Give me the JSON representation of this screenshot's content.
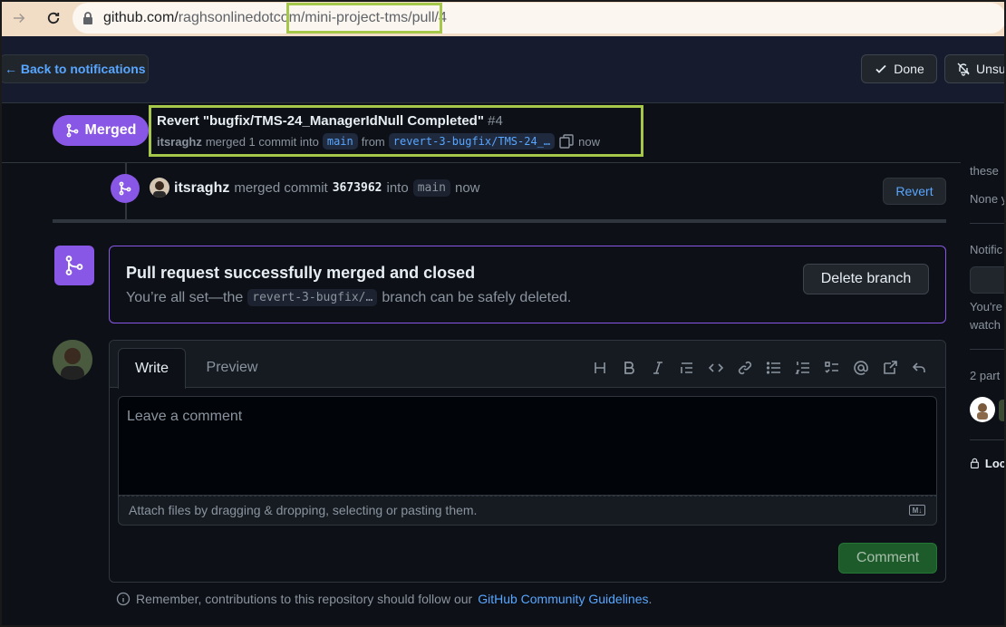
{
  "browser": {
    "url_host": "github.com/",
    "url_host_rest": "raghsonlinedotcom",
    "url_path": "/mini-project-tms/pull/4"
  },
  "notifications": {
    "back_label": "← Back to notifications",
    "done_label": "Done",
    "unsubscribe_label": "Unsu"
  },
  "pr": {
    "state_label": "Merged",
    "title": "Revert \"bugfix/TMS-24_ManagerIdNull Completed\"",
    "number": "#4",
    "author": "itsraghz",
    "merge_text": "merged 1 commit into",
    "base_branch": "main",
    "from_text": "from",
    "head_branch": "revert-3-bugfix/TMS-24_…",
    "time": "now"
  },
  "timeline": {
    "user": "itsraghz",
    "action": "merged commit",
    "sha": "3673962",
    "into": "into",
    "branch": "main",
    "time": "now",
    "revert_label": "Revert"
  },
  "merged_box": {
    "title": "Pull request successfully merged and closed",
    "sub_prefix": "You’re all set—the",
    "branch": "revert-3-bugfix/…",
    "sub_suffix": "branch can be safely deleted.",
    "delete_label": "Delete branch"
  },
  "comment": {
    "tab_write": "Write",
    "tab_preview": "Preview",
    "placeholder": "Leave a comment",
    "attach_text": "Attach files by dragging & dropping, selecting or pasting them.",
    "md_badge": "M↓",
    "submit_label": "Comment"
  },
  "guidelines": {
    "prefix": "Remember, contributions to this repository should follow our",
    "link": "GitHub Community Guidelines",
    "suffix": "."
  },
  "sidebar": {
    "these": "these",
    "none": "None y",
    "notifications_heading": "Notific",
    "youre": "You're",
    "watch": "watch",
    "participants": "2 part",
    "lock": "Loc"
  },
  "colors": {
    "accent_purple": "#8957e5",
    "link_blue": "#58a6ff",
    "highlight_green": "#a6c84a",
    "comment_green": "#1e5b2a"
  }
}
